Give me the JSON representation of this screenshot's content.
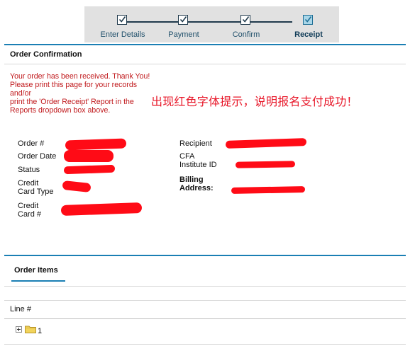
{
  "steps": [
    {
      "label": "Enter Details",
      "current": false
    },
    {
      "label": "Payment",
      "current": false
    },
    {
      "label": "Confirm",
      "current": false
    },
    {
      "label": "Receipt",
      "current": true
    }
  ],
  "confirmation": {
    "title": "Order Confirmation",
    "notice_lines": [
      "Your order has been received. Thank You!",
      "Please print this page for your records",
      "and/or",
      "print the 'Order Receipt' Report in the",
      "Reports dropdown box above."
    ],
    "annotation": "出现红色字体提示，说明报名支付成功！"
  },
  "order_fields": {
    "order_number": "Order #",
    "order_date": "Order Date",
    "status": "Status",
    "credit_card_type_1": "Credit",
    "credit_card_type_2": "Card Type",
    "credit_card_number_1": "Credit",
    "credit_card_number_2": "Card #",
    "recipient": "Recipient",
    "cfa_institute_id_1": "CFA",
    "cfa_institute_id_2": "Institute ID",
    "billing_address_1": "Billing",
    "billing_address_2": "Address:"
  },
  "order_items": {
    "tab_label": "Order Items",
    "column_header": "Line #",
    "rows": [
      {
        "line": "1"
      }
    ]
  },
  "colors": {
    "accent_blue": "#1b7fb4",
    "notice_red": "#c0191c",
    "annotation_red": "#e8182a",
    "redaction_red": "#ff0b16",
    "step_bar_bg": "#e1e1e1"
  },
  "icons": {
    "step_checkbox": "checkbox-checked-icon",
    "tree_expander": "plus-square-icon",
    "tree_folder": "folder-icon"
  }
}
